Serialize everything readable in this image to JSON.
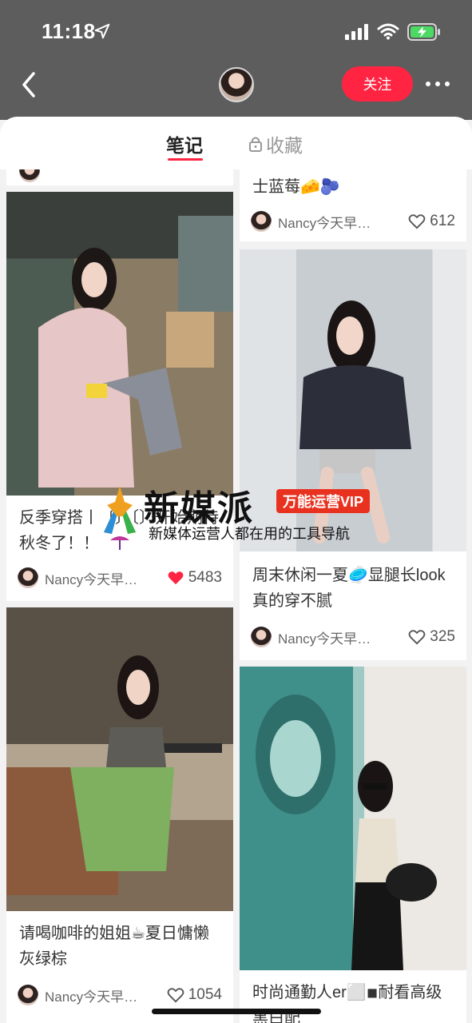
{
  "status_bar": {
    "time": "11:18"
  },
  "header": {
    "follow_label": "关注"
  },
  "tabs": {
    "notes": "笔记",
    "favorites": "收藏"
  },
  "cards": {
    "partial_right": {
      "title": "士蓝莓🧀🫐",
      "author": "Nancy今天早睡…",
      "likes": "612"
    },
    "left1": {
      "title": "反季穿搭丨〔〕〔〕开始期待秋冬了！！",
      "author": "Nancy今天早…",
      "likes": "5483"
    },
    "right1": {
      "title": "周末休闲一夏🥏显腿长look真的穿不腻",
      "author": "Nancy今天早睡…",
      "likes": "325"
    },
    "left2": {
      "title": "请喝咖啡的姐姐☕夏日慵懒灰绿棕",
      "author": "Nancy今天早…",
      "likes": "1054"
    },
    "right2": {
      "title": "时尚通勤人er⬜◾耐看高级黑白配"
    }
  },
  "watermark": {
    "title": "新媒派",
    "badge": "万能运营VIP",
    "subtitle": "新媒体运营人都在用的工具导航"
  },
  "colors": {
    "accent": "#ff2442",
    "liked": "#ff2442"
  }
}
